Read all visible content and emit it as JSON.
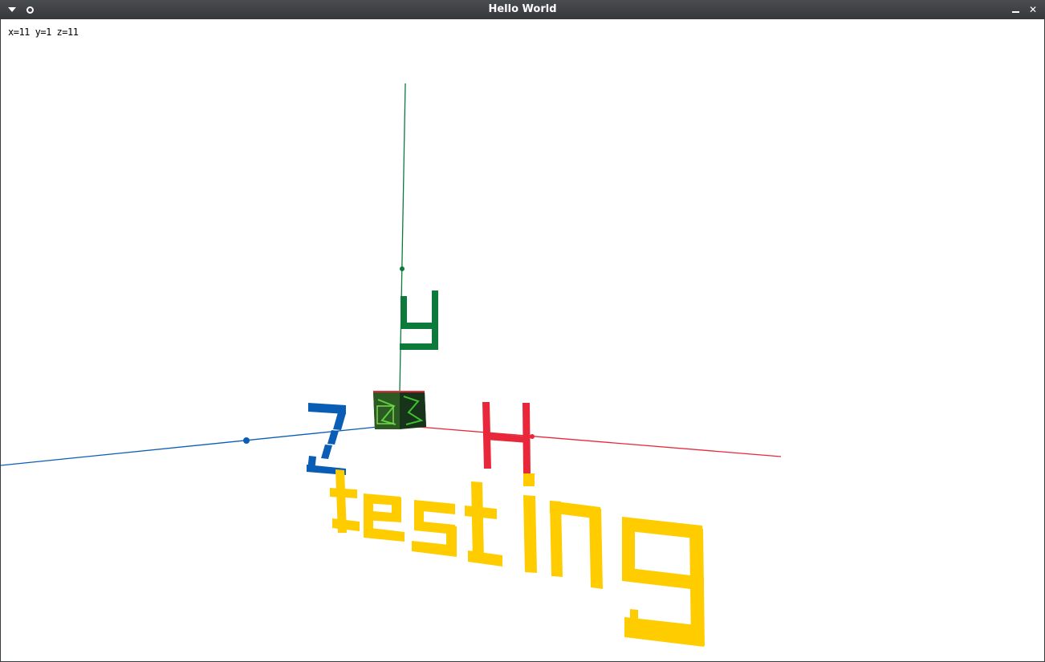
{
  "window": {
    "title": "Hello World",
    "menu_icon": "chevron-down-icon",
    "sticky_icon": "circle-icon",
    "minimize_icon": "minimize-icon",
    "close_icon": "close-icon",
    "close_glyph": "✕"
  },
  "overlay": {
    "coords_text": "x=11 y=1 z=11"
  },
  "scene": {
    "axis_labels": {
      "x": "x",
      "y": "y",
      "z": "z"
    },
    "floating_text": "testing",
    "colors": {
      "x_axis": "#e8283a",
      "y_axis": "#0b7a3b",
      "z_axis": "#0a5db5",
      "text": "#ffcc00",
      "background": "#ffffff"
    }
  }
}
